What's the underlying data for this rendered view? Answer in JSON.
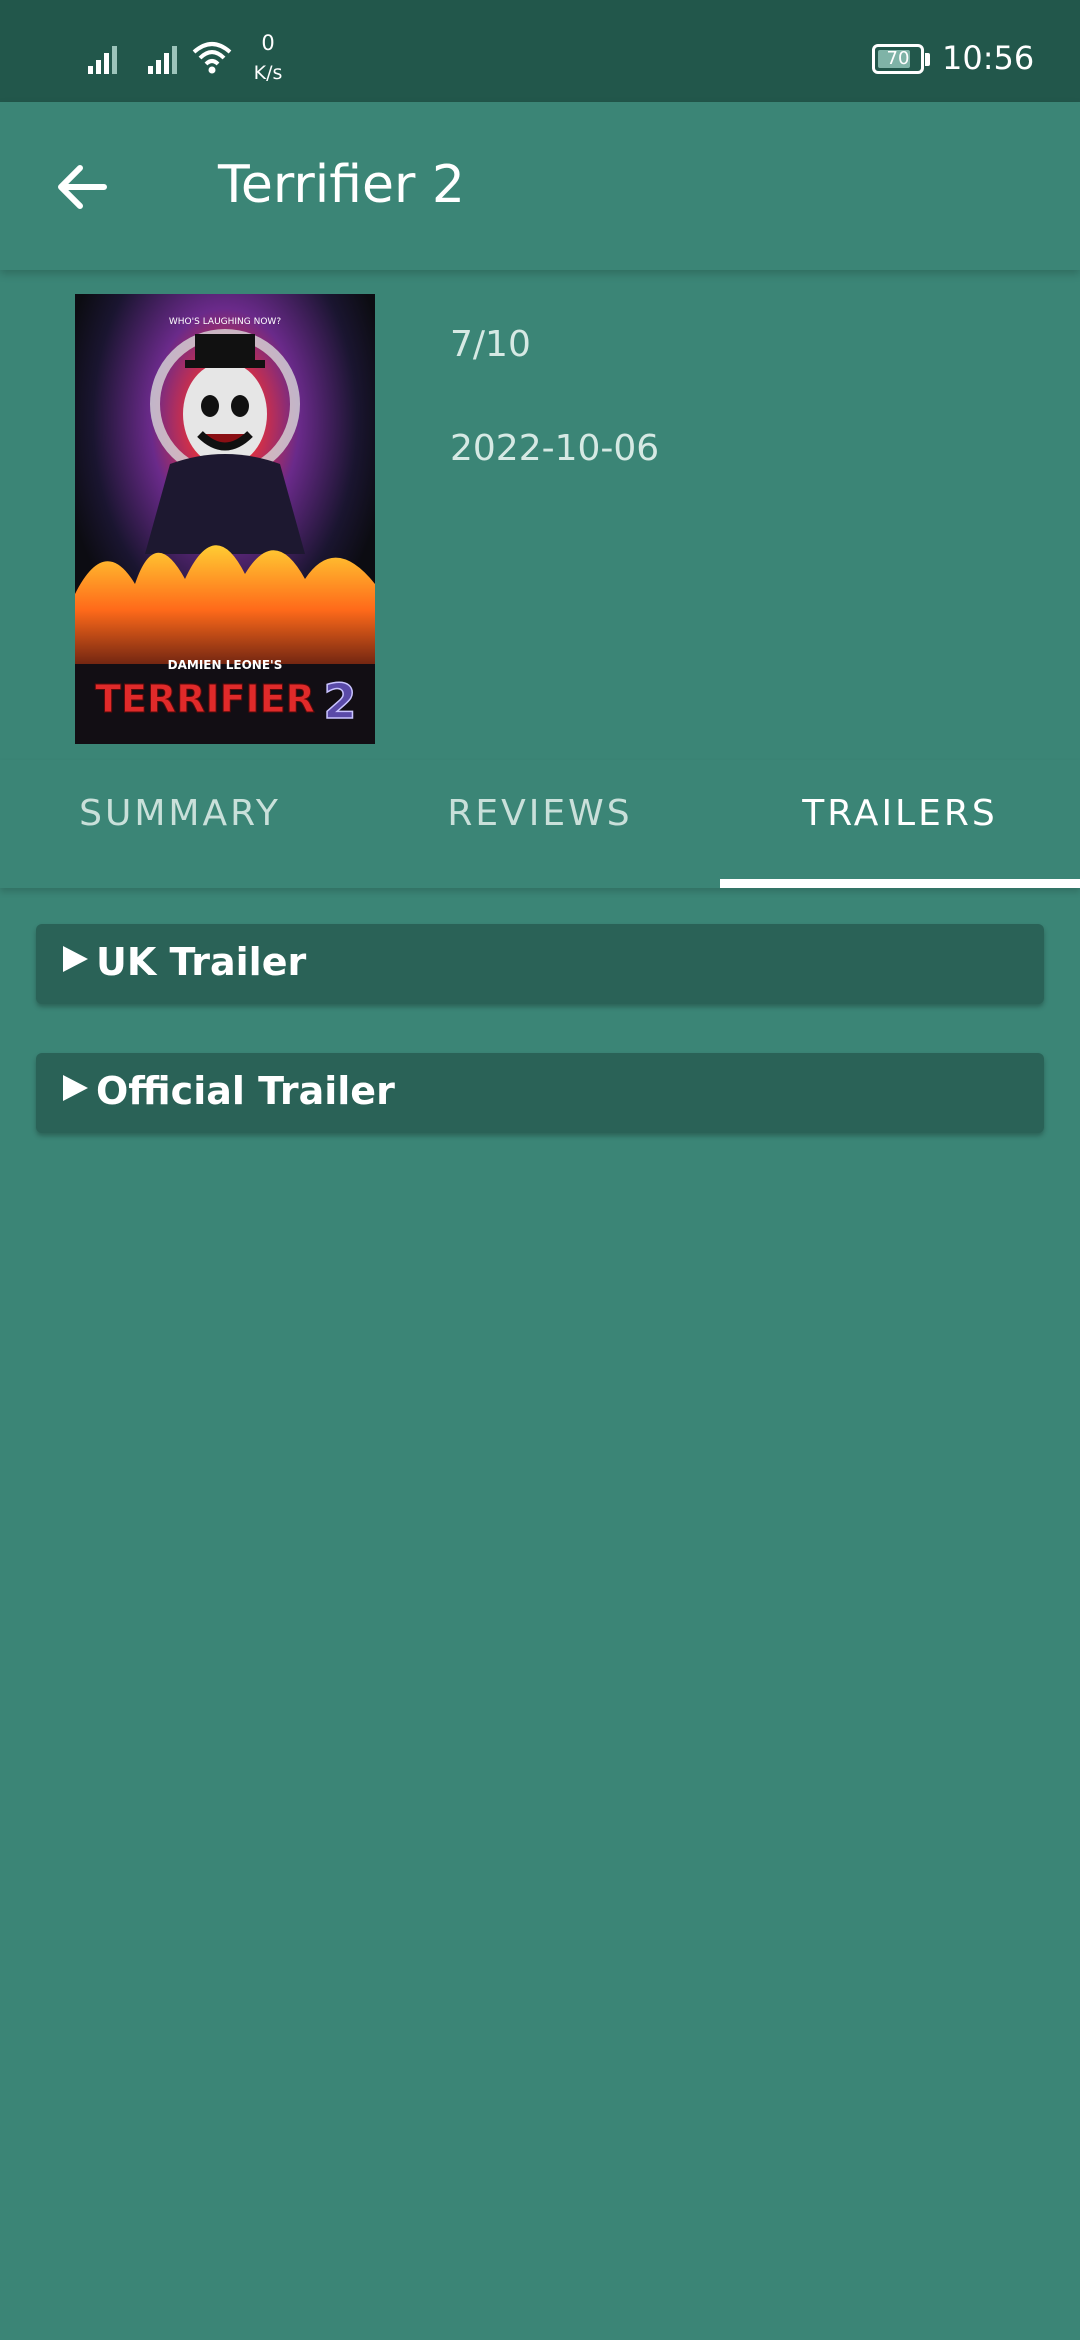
{
  "status_bar": {
    "speed_value": "0",
    "speed_unit": "K/s",
    "battery_level": "70",
    "time": "10:56",
    "icons": [
      "signal-icon",
      "signal-icon",
      "wifi-icon",
      "battery-icon"
    ]
  },
  "app_bar": {
    "title": "Terrifier 2",
    "back_icon": "arrow-left-icon"
  },
  "movie": {
    "poster_tagline": "WHO'S LAUGHING NOW?",
    "poster_credit": "DAMIEN LEONE'S",
    "poster_title": "TERRIFIER",
    "poster_number": "2",
    "rating": "7/10",
    "release_date": "2022-10-06"
  },
  "tabs": [
    {
      "label": "SUMMARY",
      "active": false
    },
    {
      "label": "REVIEWS",
      "active": false
    },
    {
      "label": "TRAILERS",
      "active": true
    }
  ],
  "trailers": [
    {
      "label": "UK Trailer",
      "icon": "play-icon"
    },
    {
      "label": "Official Trailer",
      "icon": "play-icon"
    }
  ],
  "colors": {
    "background": "#3b8576",
    "status_bar": "#22574b",
    "card": "#2a6257",
    "accent": "#ffffff"
  }
}
